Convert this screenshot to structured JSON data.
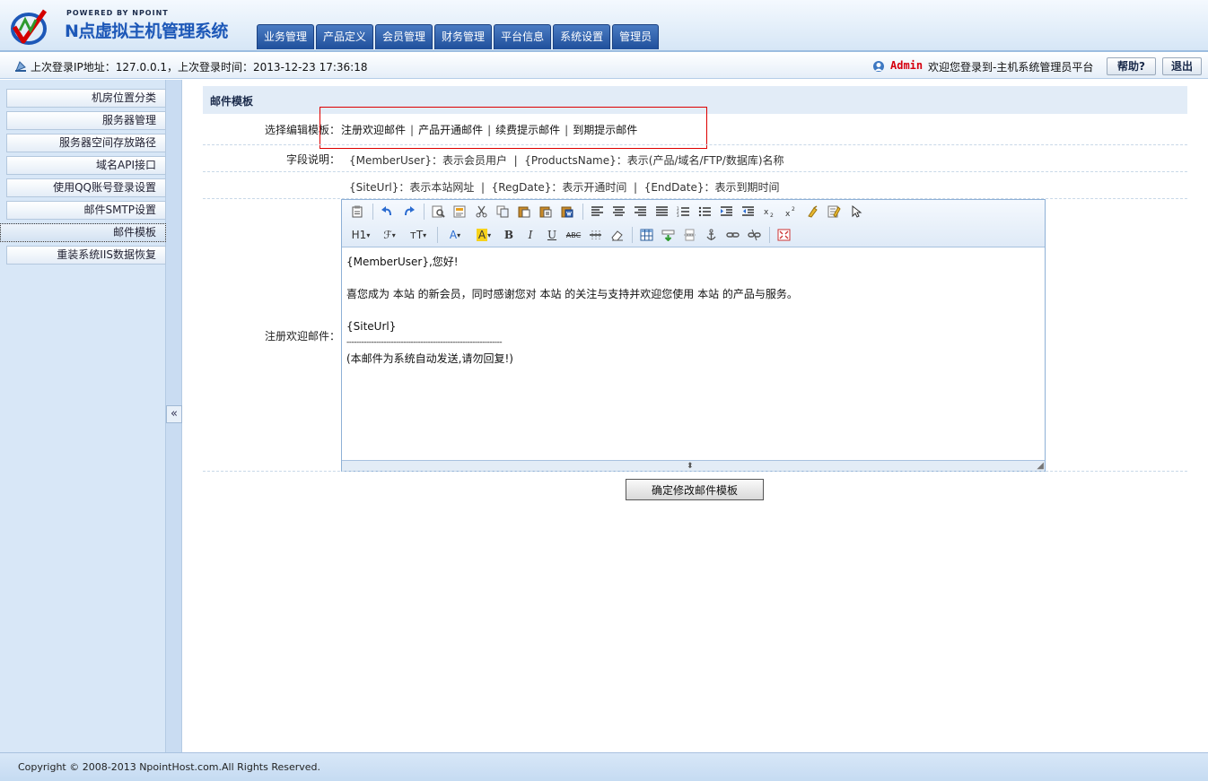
{
  "header": {
    "powered_by": "POWERED BY NPOINT",
    "system_name": "N点虚拟主机管理系统",
    "nav": [
      "业务管理",
      "产品定义",
      "会员管理",
      "财务管理",
      "平台信息",
      "系统设置",
      "管理员"
    ]
  },
  "infobar": {
    "login_info": "上次登录IP地址：127.0.0.1，上次登录时间：2013-12-23 17:36:18",
    "admin_name": "Admin",
    "welcome": "欢迎您登录到-主机系统管理员平台",
    "help_label": "帮助?",
    "logout_label": "退出"
  },
  "sidebar": {
    "items": [
      "机房位置分类",
      "服务器管理",
      "服务器空间存放路径",
      "域名API接口",
      "使用QQ账号登录设置",
      "邮件SMTP设置",
      "邮件模板",
      "重装系统IIS数据恢复"
    ],
    "active_index": 6,
    "collapse_label": "«"
  },
  "main": {
    "panel_title": "邮件模板",
    "select_label": "选择编辑模板：",
    "template_links": [
      "注册欢迎邮件",
      "产品开通邮件",
      "续费提示邮件",
      "到期提示邮件"
    ],
    "fields_label": "字段说明：",
    "field_line_1": "{MemberUser}：表示会员用户  |  {ProductsName}：表示(产品/域名/FTP/数据库)名称",
    "field_line_2": "{SiteUrl}：表示本站网址  |  {RegDate}：表示开通时间  |  {EndDate}：表示到期时间",
    "editor_label": "注册欢迎邮件：",
    "editor_lines": [
      "{MemberUser},您好!",
      "",
      "喜您成为 本站 的新会员，同时感谢您对 本站 的关注与支持并欢迎您使用 本站 的产品与服务。",
      "",
      "{SiteUrl}",
      "---------------------------------------------------------------",
      "(本邮件为系统自动发送,请勿回复!)"
    ],
    "toolbar": {
      "heading": "H1",
      "font_family": "ℱ",
      "font_size": "тT",
      "font_color": "A",
      "bg_color": "A",
      "bold": "B",
      "italic": "I",
      "underline": "U",
      "strike": "ABC"
    },
    "submit_label": "确定修改邮件模板"
  },
  "footer": {
    "copyright": "Copyright © 2008-2013 NpointHost.com.All Rights Reserved."
  }
}
